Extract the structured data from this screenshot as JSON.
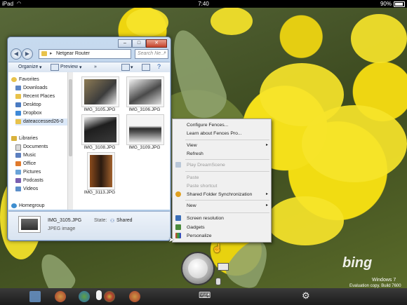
{
  "status_bar": {
    "device": "iPad",
    "time": "7:40",
    "battery": "90%",
    "battery_level": 0.9
  },
  "explorer": {
    "address": "Netgear Router",
    "search_placeholder": "Search Ne...",
    "toolbar": {
      "organize": "Organize",
      "preview": "Preview",
      "more": "»"
    },
    "nav": {
      "favorites": "Favorites",
      "favorites_items": [
        "Downloads",
        "Recent Places",
        "Desktop",
        "Dropbox",
        "dateaccessed26-0"
      ],
      "libraries": "Libraries",
      "libraries_items": [
        "Documents",
        "Music",
        "Office",
        "Pictures",
        "Podcasts",
        "Videos"
      ],
      "homegroup": "Homegroup"
    },
    "files": [
      "IMG_3105.JPG",
      "IMG_3106.JPG",
      "IMG_3108.JPG",
      "IMG_3109.JPG",
      "IMG_3113.JPG"
    ],
    "details": {
      "name": "IMG_3105.JPG",
      "type": "JPEG image",
      "state_label": "State:",
      "state_value": "Shared"
    }
  },
  "context_menu": {
    "items": [
      {
        "label": "Configure Fences...",
        "enabled": true
      },
      {
        "label": "Learn about Fences Pro...",
        "enabled": true
      },
      {
        "label": "View",
        "enabled": true,
        "submenu": true
      },
      {
        "label": "Refresh",
        "enabled": true
      },
      {
        "label": "Play DreamScene",
        "enabled": false
      },
      {
        "label": "Paste",
        "enabled": false
      },
      {
        "label": "Paste shortcut",
        "enabled": false
      },
      {
        "label": "Shared Folder Synchronization",
        "enabled": true,
        "submenu": true
      },
      {
        "label": "New",
        "enabled": true,
        "submenu": true
      },
      {
        "label": "Screen resolution",
        "enabled": true
      },
      {
        "label": "Gadgets",
        "enabled": true
      },
      {
        "label": "Personalize",
        "enabled": true
      }
    ],
    "submenu_arrow": "▸"
  },
  "watermark": {
    "brand": "bing",
    "os": "Windows 7",
    "build": "Evaluation copy. Build 7600"
  },
  "icons": {
    "refresh": "refresh-icon",
    "search": "search-icon",
    "gear": "gear-icon",
    "keyboard": "keyboard-icon",
    "hand": "hand-icon",
    "mouse": "mouse-icon"
  },
  "colors": {
    "accent": "#3a63a8",
    "menu_bg": "#f0f0f0",
    "wallpaper_yellow": "#f4e01a"
  }
}
